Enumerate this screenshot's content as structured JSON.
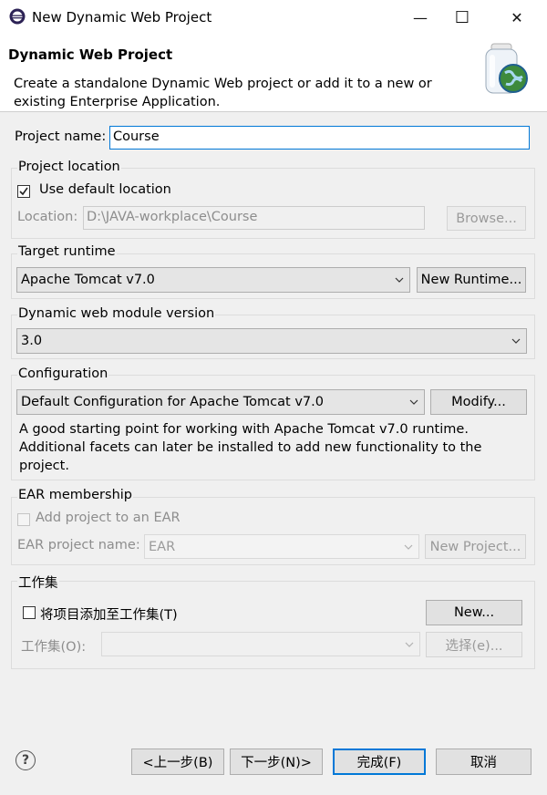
{
  "window": {
    "title": "New Dynamic Web Project",
    "minimize_glyph": "—",
    "maximize_glyph": "☐",
    "close_glyph": "✕"
  },
  "header": {
    "title": "Dynamic Web Project",
    "description": "Create a standalone Dynamic Web project or add it to a new or existing Enterprise Application."
  },
  "project_name": {
    "label": "Project name:",
    "value": "Course"
  },
  "location_group": {
    "title": "Project location",
    "use_default_label": "Use default location",
    "use_default_checked": true,
    "location_label": "Location:",
    "location_value": "D:\\JAVA-workplace\\Course",
    "browse_label": "Browse..."
  },
  "target_runtime": {
    "title": "Target runtime",
    "selected": "Apache Tomcat v7.0",
    "new_runtime_label": "New Runtime..."
  },
  "module_version": {
    "title": "Dynamic web module version",
    "selected": "3.0"
  },
  "configuration": {
    "title": "Configuration",
    "selected": "Default Configuration for Apache Tomcat v7.0",
    "modify_label": "Modify...",
    "description": "A good starting point for working with Apache Tomcat v7.0 runtime. Additional facets can later be installed to add new functionality to the project."
  },
  "ear": {
    "title": "EAR membership",
    "add_label": "Add project to an EAR",
    "add_checked": false,
    "name_label": "EAR project name:",
    "name_value": "EAR",
    "new_project_label": "New Project..."
  },
  "working_sets": {
    "title": "工作集",
    "add_label": "将项目添加至工作集(T)",
    "add_checked": false,
    "new_label": "New...",
    "sets_label": "工作集(O):",
    "select_label": "选择(e)..."
  },
  "footer": {
    "help_glyph": "?",
    "back_label": "<上一步(B)",
    "next_label": "下一步(N)>",
    "finish_label": "完成(F)",
    "cancel_label": "取消"
  },
  "colors": {
    "focus_border": "#0078d7",
    "dialog_bg": "#f0f0f0"
  },
  "icons": {
    "app": "eclipse-icon",
    "header": "web-project-jar-globe-icon",
    "help": "help-icon"
  }
}
